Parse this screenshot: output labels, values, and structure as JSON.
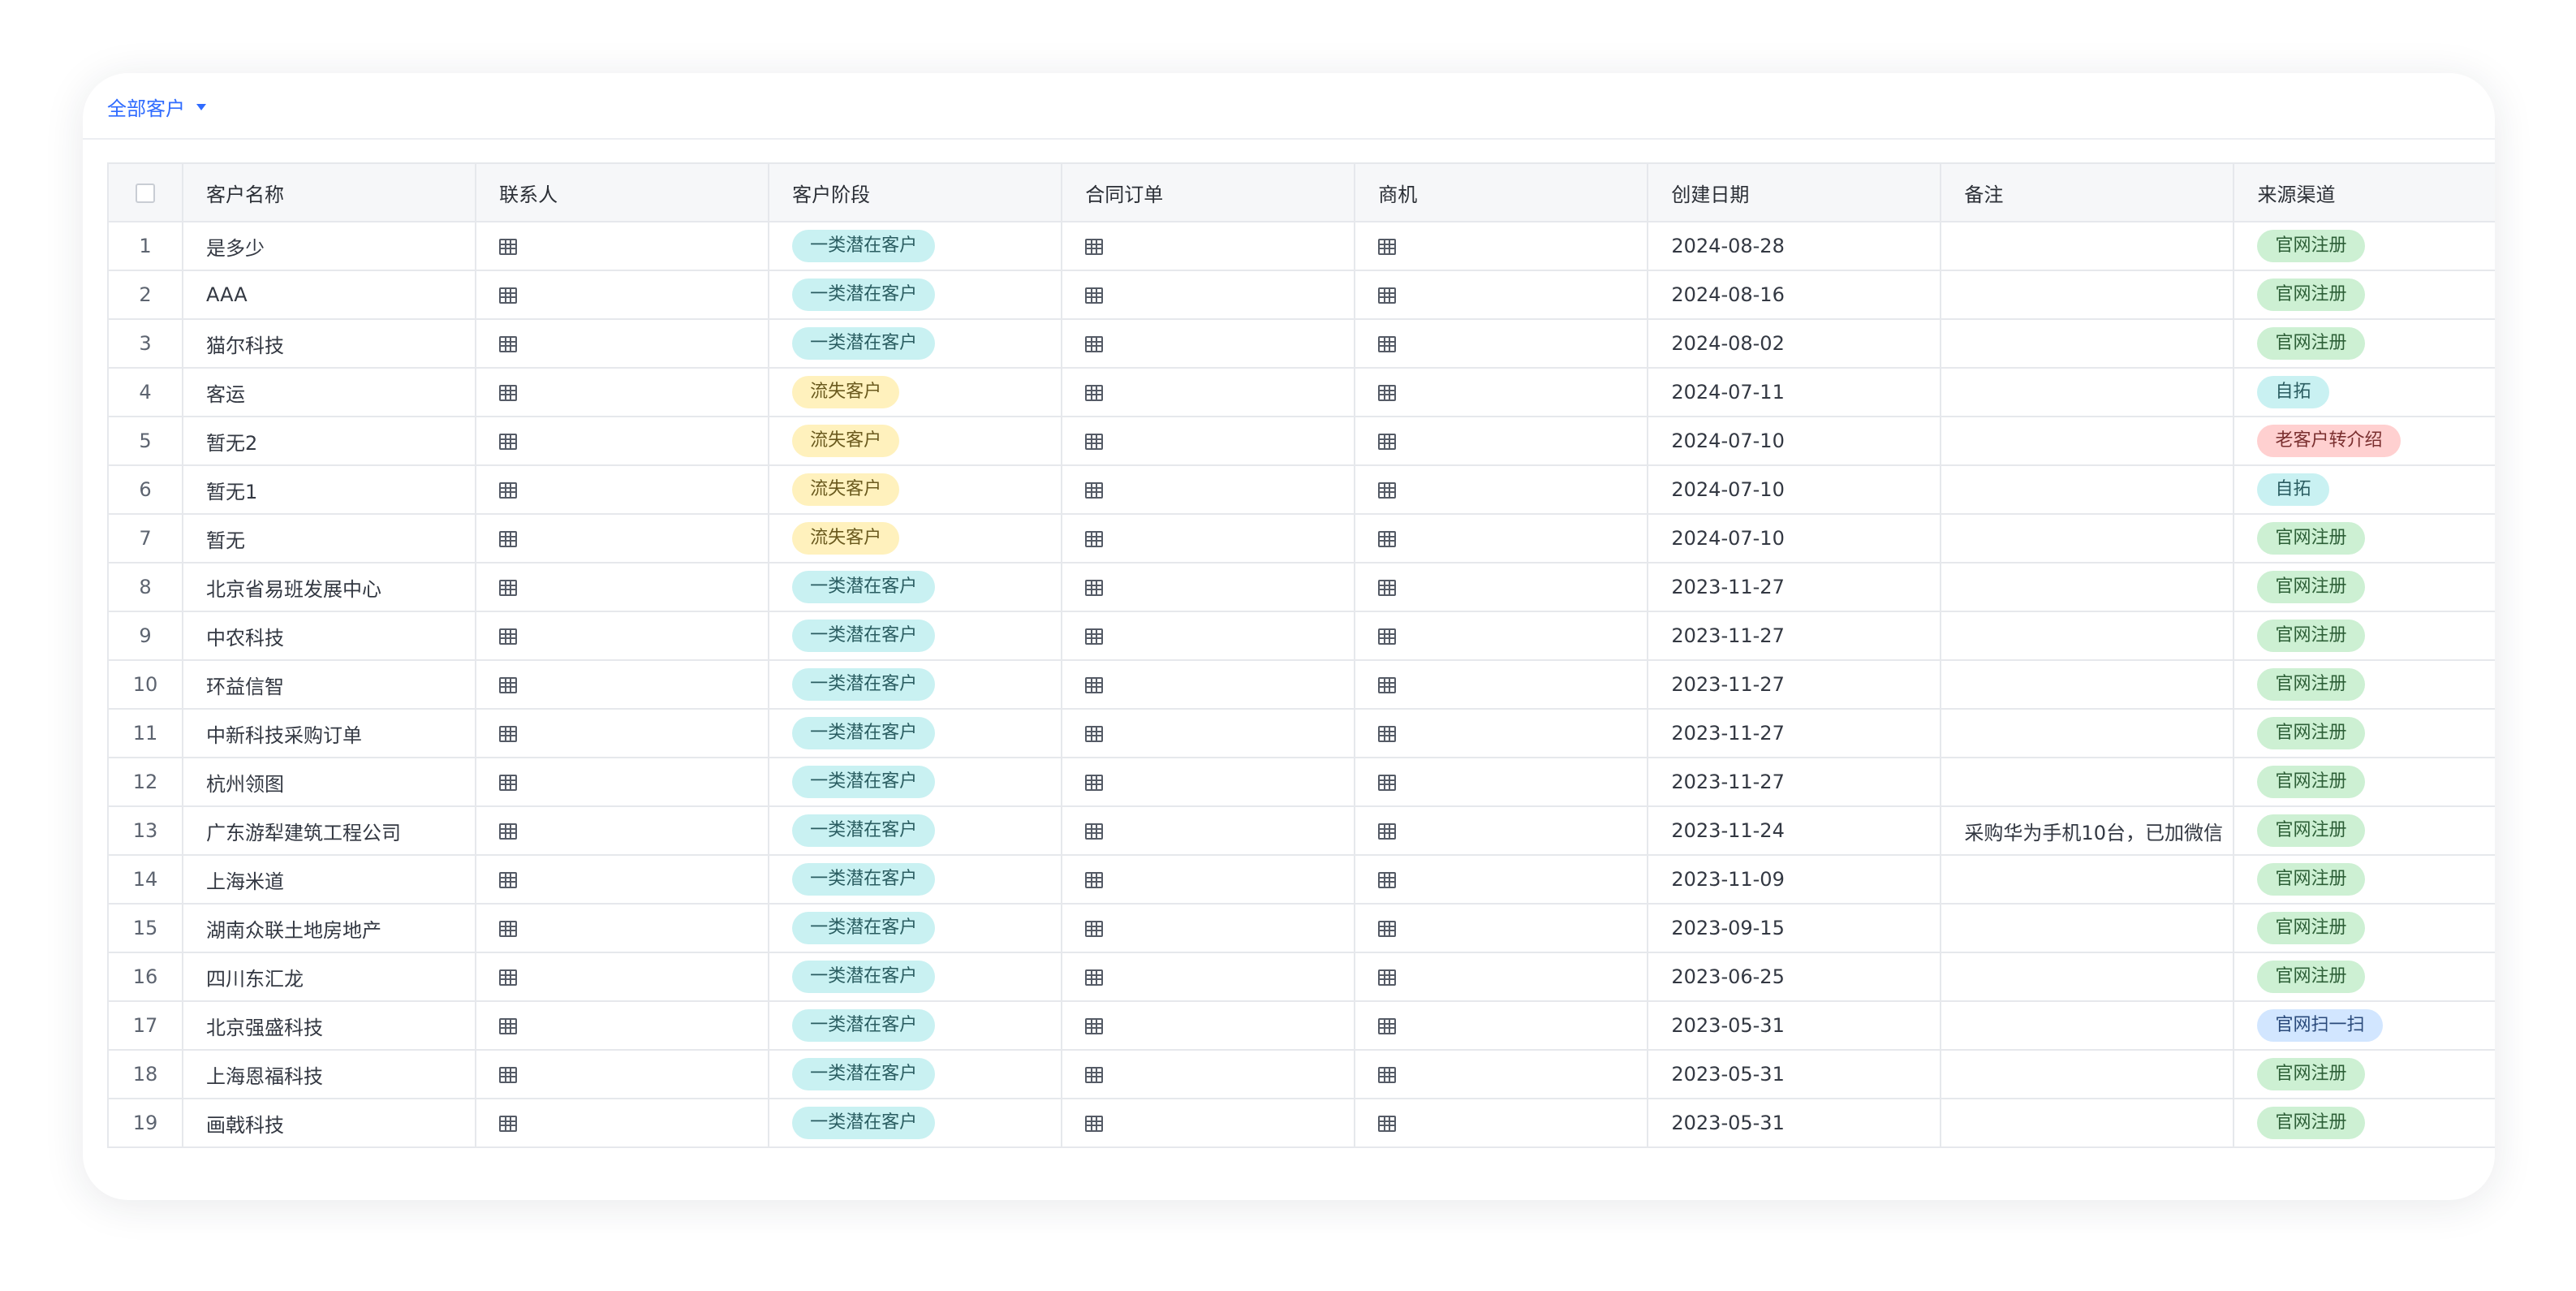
{
  "view": {
    "label": "全部客户"
  },
  "columns": [
    "客户名称",
    "联系人",
    "客户阶段",
    "合同订单",
    "商机",
    "创建日期",
    "备注",
    "来源渠道"
  ],
  "rows": [
    {
      "idx": "1",
      "name": "是多少",
      "stage": "一类潜在客户",
      "stage_color": "cyan",
      "date": "2024-08-28",
      "note": "",
      "source": "官网注册",
      "source_color": "green"
    },
    {
      "idx": "2",
      "name": "AAA",
      "stage": "一类潜在客户",
      "stage_color": "cyan",
      "date": "2024-08-16",
      "note": "",
      "source": "官网注册",
      "source_color": "green"
    },
    {
      "idx": "3",
      "name": "猫尔科技",
      "stage": "一类潜在客户",
      "stage_color": "cyan",
      "date": "2024-08-02",
      "note": "",
      "source": "官网注册",
      "source_color": "green"
    },
    {
      "idx": "4",
      "name": "客运",
      "stage": "流失客户",
      "stage_color": "yellow",
      "date": "2024-07-11",
      "note": "",
      "source": "自拓",
      "source_color": "cyan"
    },
    {
      "idx": "5",
      "name": "暂无2",
      "stage": "流失客户",
      "stage_color": "yellow",
      "date": "2024-07-10",
      "note": "",
      "source": "老客户转介绍",
      "source_color": "red"
    },
    {
      "idx": "6",
      "name": "暂无1",
      "stage": "流失客户",
      "stage_color": "yellow",
      "date": "2024-07-10",
      "note": "",
      "source": "自拓",
      "source_color": "cyan"
    },
    {
      "idx": "7",
      "name": "暂无",
      "stage": "流失客户",
      "stage_color": "yellow",
      "date": "2024-07-10",
      "note": "",
      "source": "官网注册",
      "source_color": "green"
    },
    {
      "idx": "8",
      "name": "北京省易班发展中心",
      "stage": "一类潜在客户",
      "stage_color": "cyan",
      "date": "2023-11-27",
      "note": "",
      "source": "官网注册",
      "source_color": "green"
    },
    {
      "idx": "9",
      "name": "中农科技",
      "stage": "一类潜在客户",
      "stage_color": "cyan",
      "date": "2023-11-27",
      "note": "",
      "source": "官网注册",
      "source_color": "green"
    },
    {
      "idx": "10",
      "name": "环益信智",
      "stage": "一类潜在客户",
      "stage_color": "cyan",
      "date": "2023-11-27",
      "note": "",
      "source": "官网注册",
      "source_color": "green"
    },
    {
      "idx": "11",
      "name": "中新科技采购订单",
      "stage": "一类潜在客户",
      "stage_color": "cyan",
      "date": "2023-11-27",
      "note": "",
      "source": "官网注册",
      "source_color": "green"
    },
    {
      "idx": "12",
      "name": "杭州领图",
      "stage": "一类潜在客户",
      "stage_color": "cyan",
      "date": "2023-11-27",
      "note": "",
      "source": "官网注册",
      "source_color": "green"
    },
    {
      "idx": "13",
      "name": "广东游犁建筑工程公司",
      "stage": "一类潜在客户",
      "stage_color": "cyan",
      "date": "2023-11-24",
      "note": "采购华为手机10台，已加微信",
      "source": "官网注册",
      "source_color": "green"
    },
    {
      "idx": "14",
      "name": "上海米道",
      "stage": "一类潜在客户",
      "stage_color": "cyan",
      "date": "2023-11-09",
      "note": "",
      "source": "官网注册",
      "source_color": "green"
    },
    {
      "idx": "15",
      "name": "湖南众联土地房地产",
      "stage": "一类潜在客户",
      "stage_color": "cyan",
      "date": "2023-09-15",
      "note": "",
      "source": "官网注册",
      "source_color": "green"
    },
    {
      "idx": "16",
      "name": "四川东汇龙",
      "stage": "一类潜在客户",
      "stage_color": "cyan",
      "date": "2023-06-25",
      "note": "",
      "source": "官网注册",
      "source_color": "green"
    },
    {
      "idx": "17",
      "name": "北京强盛科技",
      "stage": "一类潜在客户",
      "stage_color": "cyan",
      "date": "2023-05-31",
      "note": "",
      "source": "官网扫一扫",
      "source_color": "blue"
    },
    {
      "idx": "18",
      "name": "上海恩福科技",
      "stage": "一类潜在客户",
      "stage_color": "cyan",
      "date": "2023-05-31",
      "note": "",
      "source": "官网注册",
      "source_color": "green"
    },
    {
      "idx": "19",
      "name": "画戟科技",
      "stage": "一类潜在客户",
      "stage_color": "cyan",
      "date": "2023-05-31",
      "note": "",
      "source": "官网注册",
      "source_color": "green"
    }
  ]
}
